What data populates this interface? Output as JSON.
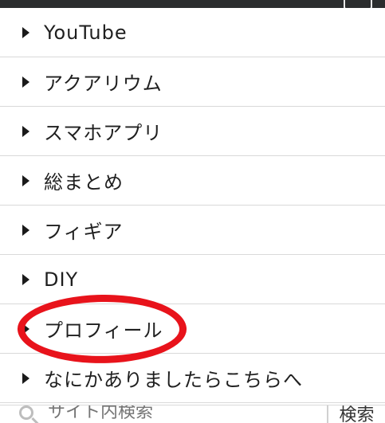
{
  "menu": {
    "items": [
      {
        "label": "YouTube"
      },
      {
        "label": "アクアリウム"
      },
      {
        "label": "スマホアプリ"
      },
      {
        "label": "総まとめ"
      },
      {
        "label": "フィギア"
      },
      {
        "label": "DIY"
      },
      {
        "label": "プロフィール"
      },
      {
        "label": "なにかありましたらこちらへ"
      }
    ]
  },
  "search": {
    "placeholder": "サイト内検索",
    "button_label": "検索"
  },
  "colors": {
    "topbar": "#2b2d2e",
    "highlight": "#e8131b"
  },
  "annotation": {
    "highlighted_item": "プロフィール"
  }
}
